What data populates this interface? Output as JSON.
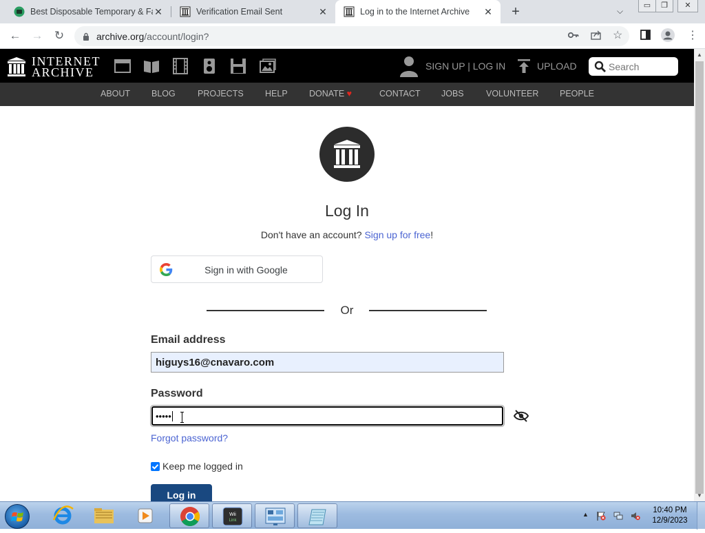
{
  "browser": {
    "tabs": [
      {
        "title": "Best Disposable Temporary & Fa",
        "active": false
      },
      {
        "title": "Verification Email Sent",
        "active": false
      },
      {
        "title": "Log in to the Internet Archive",
        "active": true
      }
    ],
    "url_host": "archive.org",
    "url_path": "/account/login?"
  },
  "ia_header": {
    "logo_line1": "INTERNET",
    "logo_line2": "ARCHIVE",
    "signup_login": "SIGN UP | LOG IN",
    "upload": "UPLOAD",
    "search_placeholder": "Search",
    "nav": [
      "ABOUT",
      "BLOG",
      "PROJECTS",
      "HELP",
      "DONATE",
      "CONTACT",
      "JOBS",
      "VOLUNTEER",
      "PEOPLE"
    ],
    "donate_heart": "♥"
  },
  "login": {
    "title": "Log In",
    "no_account": "Don't have an account?",
    "signup_link": "Sign up for free",
    "signup_suffix": "!",
    "google_button": "Sign in with Google",
    "or": "Or",
    "email_label": "Email address",
    "email_value": "higuys16@cnavaro.com",
    "password_label": "Password",
    "password_mask": "•••••",
    "forgot": "Forgot password?",
    "keep_logged_in": "Keep me logged in",
    "keep_checked": true,
    "login_button": "Log in"
  },
  "taskbar": {
    "time": "10:40 PM",
    "date": "12/9/2023"
  },
  "colors": {
    "link": "#4b64d2",
    "ia_header_bg": "#000000",
    "ia_nav_bg": "#333333",
    "login_button": "#194880",
    "donate_heart": "#e0271f"
  }
}
